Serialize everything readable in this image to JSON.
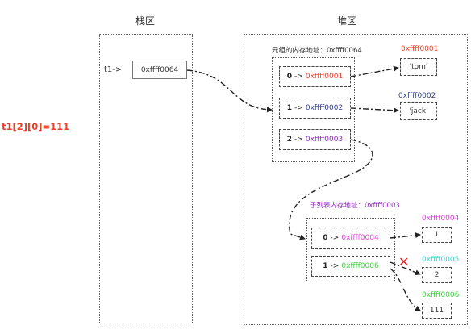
{
  "headers": {
    "stack": "栈区",
    "heap": "堆区"
  },
  "statement": "t1[2][0]=111",
  "stack": {
    "var_label": "t1->",
    "value": "0xffff0064"
  },
  "outer_list": {
    "caption": "元组的内存地址：0xffff0064",
    "items": [
      {
        "index": "0",
        "arrow": "->",
        "addr": "0xffff0001",
        "color": "#e8402c"
      },
      {
        "index": "1",
        "arrow": "->",
        "addr": "0xffff0002",
        "color": "#2f3d8c"
      },
      {
        "index": "2",
        "arrow": "->",
        "addr": "0xffff0003",
        "color": "#8b2fb5"
      }
    ]
  },
  "inner_list": {
    "caption": "子列表内存地址：0xffff0003",
    "caption_color": "#8b2fb5",
    "items": [
      {
        "index": "0",
        "arrow": "->",
        "addr": "0xffff0004",
        "color": "#e040d8"
      },
      {
        "index": "1",
        "arrow": "->",
        "addr": "0xffff0006",
        "color": "#3dd13d"
      }
    ]
  },
  "objects": [
    {
      "addr": "0xffff0001",
      "value": "'tom'",
      "color": "#e8402c"
    },
    {
      "addr": "0xffff0002",
      "value": "'jack'",
      "color": "#2f3d8c"
    },
    {
      "addr": "0xffff0004",
      "value": "1",
      "color": "#e040d8"
    },
    {
      "addr": "0xffff0005",
      "value": "2",
      "color": "#3ad6d6"
    },
    {
      "addr": "0xffff0006",
      "value": "111",
      "color": "#3dd13d"
    }
  ],
  "marker": {
    "symbol": "✕",
    "color": "#e02020"
  }
}
